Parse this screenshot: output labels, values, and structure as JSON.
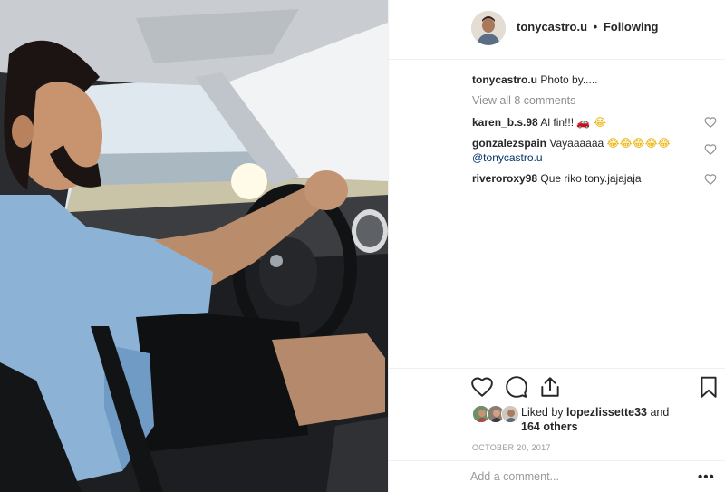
{
  "post": {
    "username": "tonycastro.u",
    "follow_separator": "•",
    "follow_status": "Following",
    "caption": {
      "username": "tonycastro.u",
      "text": "Photo by....."
    },
    "view_all_comments": "View all 8 comments",
    "comments": [
      {
        "username": "karen_b.s.98",
        "text": "Al fin!!!",
        "emoji": "🚗 😂"
      },
      {
        "username": "gonzalezspain",
        "text": "Vayaaaaaa",
        "emoji": "😂😂😂😂😂",
        "mention": "@tonycastro.u"
      },
      {
        "username": "riveroroxy98",
        "text": "Que riko tony.jajajaja"
      }
    ],
    "likes": {
      "prefix": "Liked by",
      "user": "lopezlissette33",
      "suffix_1": "and",
      "suffix_2": "164 others"
    },
    "date": "OCTOBER 20, 2017",
    "add_comment_placeholder": "Add a comment...",
    "more_options": "•••"
  },
  "icons": {
    "like": "heart-outline-icon",
    "comment": "speech-bubble-icon",
    "share": "share-upload-icon",
    "save": "bookmark-icon",
    "comment_like": "small-heart-icon"
  },
  "colors": {
    "text": "#262626",
    "muted": "#8e8e8e",
    "mention": "#003569",
    "border": "#efefef"
  }
}
